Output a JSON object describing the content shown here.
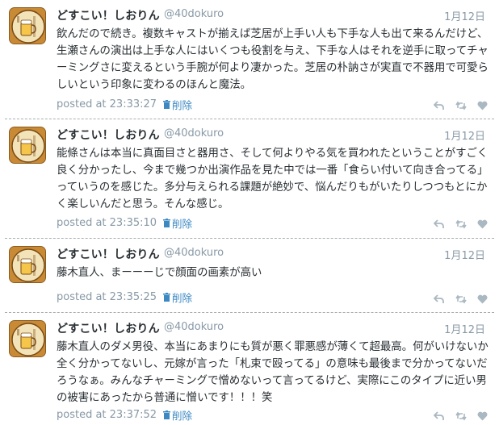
{
  "tweets": [
    {
      "name": "どすこい！しおりん",
      "handle": "@40dokuro",
      "date": "1月12日",
      "text": "飲んだので続き。複数キャストが揃えば芝居が上手い人も下手な人も出て来るんだけど、生瀬さんの演出は上手な人にはいくつも役割を与え、下手な人はそれを逆手に取ってチャーミングさに変えるという手腕が何より凄かった。芝居の朴訥さが実直で不器用で可愛らしいという印象に変わるのほんと魔法。",
      "time": "posted at 23:33:27",
      "delete_label": "削除"
    },
    {
      "name": "どすこい！しおりん",
      "handle": "@40dokuro",
      "date": "1月12日",
      "text": "能條さんは本当に真面目さと器用さ、そして何よりやる気を買われたということがすごく良く分かったし、今まで幾つか出演作品を見た中では一番「食らい付いて向き合ってる」っていうのを感じた。多分与えられる課題が絶妙で、悩んだりもがいたりしつつもとにかく楽しいんだと思う。そんな感じ。",
      "time": "posted at 23:35:10",
      "delete_label": "削除"
    },
    {
      "name": "どすこい！しおりん",
      "handle": "@40dokuro",
      "date": "1月12日",
      "text": "藤木直人、まーーーじで顔面の画素が高い",
      "time": "posted at 23:35:25",
      "delete_label": "削除"
    },
    {
      "name": "どすこい！しおりん",
      "handle": "@40dokuro",
      "date": "1月12日",
      "text": "藤木直人のダメ男役、本当にあまりにも質が悪く罪悪感が薄くて超最高。何がいけないか全く分かってないし、元嫁が言った「札束で殴ってる」の意味も最後まで分かってないだろうなぁ。みんなチャーミングで憎めないって言ってるけど、実際にこのタイプに近い男の被害にあったから普通に憎いです！！！笑",
      "time": "posted at 23:37:52",
      "delete_label": "削除"
    }
  ],
  "icons": [
    "reply-icon",
    "retweet-icon",
    "like-icon",
    "trash-icon"
  ],
  "colors": {
    "link": "#3b88c3",
    "muted": "#8899a6",
    "text": "#292f33",
    "icon": "#aab8c2"
  }
}
